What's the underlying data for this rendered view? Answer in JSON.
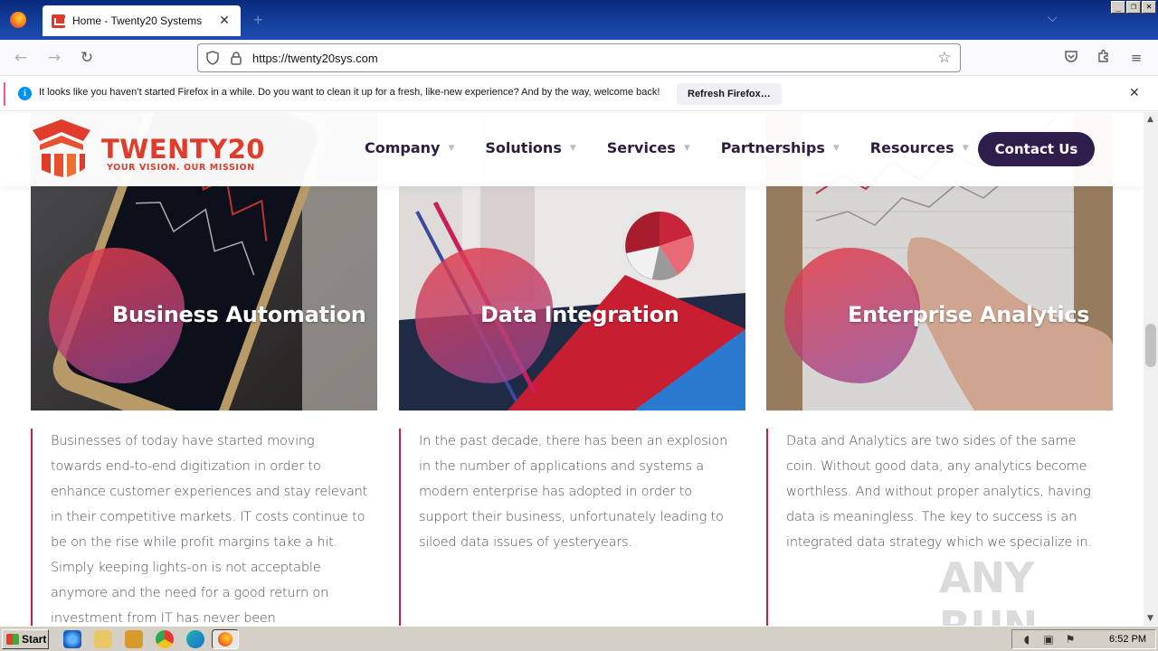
{
  "browser": {
    "tab_title": "Home - Twenty20 Systems",
    "url": "https://twenty20sys.com",
    "notification": {
      "text": "It looks like you haven’t started Firefox in a while. Do you want to clean it up for a fresh, like-new experience? And by the way, welcome back!",
      "button_label": "Refresh Firefox…"
    }
  },
  "site": {
    "logo": {
      "word": "TWENTY20",
      "tagline": "YOUR VISION. OUR MISSION"
    },
    "menu": [
      "Company",
      "Solutions",
      "Services",
      "Partnerships",
      "Resources"
    ],
    "cta_label": "Contact Us",
    "cards": [
      {
        "title": "Business Automation",
        "text": "Businesses of today have started moving towards end-to-end digitization in order to enhance customer experiences and stay relevant in their competitive markets. IT costs continue to be on the rise while profit margins take a hit. Simply keeping lights-on is not acceptable anymore and the need for a good return on investment from IT has never been"
      },
      {
        "title": "Data Integration",
        "text": "In the past decade, there has been an explosion in the number of applications and systems a modern enterprise has adopted in order to support their business, unfortunately leading to siloed data issues of yesteryears."
      },
      {
        "title": "Enterprise Analytics",
        "text": "Data and Analytics are two sides of the same coin. Without good data, any analytics become worthless. And without proper analytics, having data is meaningless. The key to success is an integrated data strategy which we specialize in."
      }
    ],
    "accent_color": "#c3204f",
    "brand_color": "#df3c2c",
    "cta_color": "#2f1d4c"
  },
  "watermark": "ANY RUN",
  "taskbar": {
    "start_label": "Start",
    "clock": "6:52 PM"
  }
}
